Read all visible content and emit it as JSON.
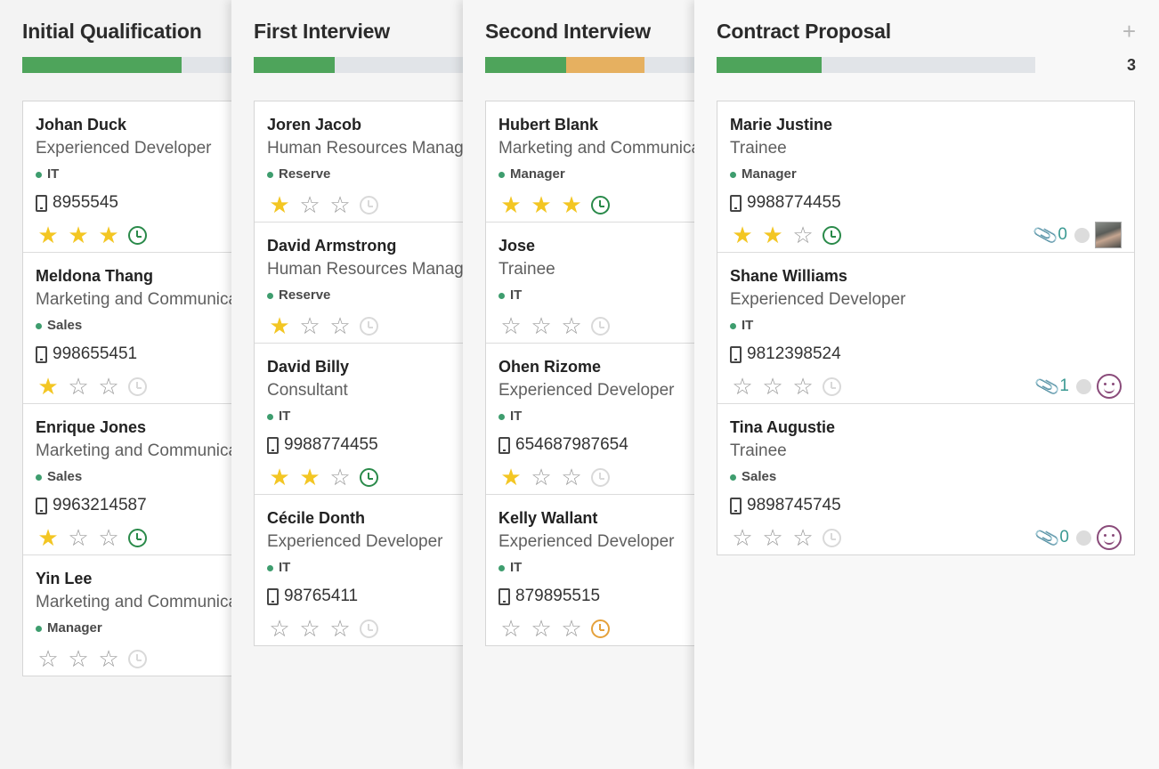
{
  "columns": [
    {
      "title": "Initial Qualification",
      "progress": [
        {
          "color": "green",
          "fraction": 0.69
        }
      ],
      "count": "",
      "cards": [
        {
          "name": "Johan Duck",
          "job": "Experienced Developer",
          "tag": "IT",
          "phone": "8955545",
          "stars": 3,
          "activity": "done"
        },
        {
          "name": "Meldona Thang",
          "job": "Marketing and Communications",
          "tag": "Sales",
          "phone": "998655451",
          "stars": 1,
          "activity": "none"
        },
        {
          "name": "Enrique Jones",
          "job": "Marketing and Communications",
          "tag": "Sales",
          "phone": "9963214587",
          "stars": 1,
          "activity": "done"
        },
        {
          "name": "Yin Lee",
          "job": "Marketing and Communications",
          "tag": "Manager",
          "phone": "",
          "stars": 0,
          "activity": "none"
        }
      ]
    },
    {
      "title": "First Interview",
      "progress": [
        {
          "color": "green",
          "fraction": 0.35
        }
      ],
      "count": "",
      "cards": [
        {
          "name": "Joren Jacob",
          "job": "Human Resources Manager",
          "tag": "Reserve",
          "phone": "",
          "stars": 1,
          "activity": "none"
        },
        {
          "name": "David Armstrong",
          "job": "Human Resources Manager",
          "tag": "Reserve",
          "phone": "",
          "stars": 1,
          "activity": "none"
        },
        {
          "name": "David Billy",
          "job": "Consultant",
          "tag": "IT",
          "phone": "9988774455",
          "stars": 2,
          "activity": "done"
        },
        {
          "name": "Cécile Donth",
          "job": "Experienced Developer",
          "tag": "IT",
          "phone": "98765411",
          "stars": 0,
          "activity": "none"
        }
      ]
    },
    {
      "title": "Second Interview",
      "progress": [
        {
          "color": "green",
          "fraction": 0.35
        },
        {
          "color": "orange",
          "fraction": 0.34
        }
      ],
      "count": "",
      "cards": [
        {
          "name": "Hubert Blank",
          "job": "Marketing and Communications",
          "tag": "Manager",
          "phone": "",
          "stars": 3,
          "activity": "done"
        },
        {
          "name": "Jose",
          "job": "Trainee",
          "tag": "IT",
          "phone": "",
          "stars": 0,
          "activity": "none"
        },
        {
          "name": "Ohen Rizome",
          "job": "Experienced Developer",
          "tag": "IT",
          "phone": "654687987654",
          "stars": 1,
          "activity": "none"
        },
        {
          "name": "Kelly Wallant",
          "job": "Experienced Developer",
          "tag": "IT",
          "phone": "879895515",
          "stars": 0,
          "activity": "warn"
        }
      ]
    },
    {
      "title": "Contract Proposal",
      "progress": [
        {
          "color": "green",
          "fraction": 0.33
        }
      ],
      "count": "3",
      "add_icon": "+",
      "cards": [
        {
          "name": "Marie Justine",
          "job": "Trainee",
          "tag": "Manager",
          "phone": "9988774455",
          "stars": 2,
          "activity": "done",
          "attachments": "0",
          "avatar": "photo"
        },
        {
          "name": "Shane Williams",
          "job": "Experienced Developer",
          "tag": "IT",
          "phone": "9812398524",
          "stars": 0,
          "activity": "none",
          "attachments": "1",
          "avatar": "smile"
        },
        {
          "name": "Tina Augustie",
          "job": "Trainee",
          "tag": "Sales",
          "phone": "9898745745",
          "stars": 0,
          "activity": "none",
          "attachments": "0",
          "avatar": "smile"
        }
      ]
    }
  ],
  "icons": {
    "star_full": "★",
    "star_empty": "☆",
    "paperclip": "📎"
  }
}
